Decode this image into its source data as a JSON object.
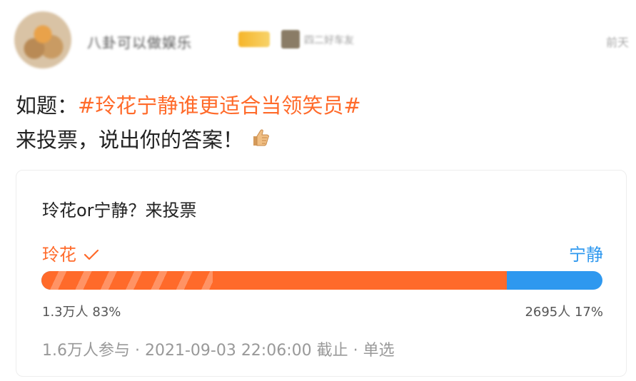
{
  "header": {
    "username": "八卦可以做娱乐",
    "badge_text": "四二好车友",
    "time": "前天"
  },
  "post": {
    "prefix": "如题：",
    "hashtag": "#玲花宁静谁更适合当领笑员#",
    "line2": "来投票，说出你的答案！",
    "emoji_icon": "thumbs-up-icon"
  },
  "poll": {
    "title": "玲花or宁静？来投票",
    "option_a": {
      "label": "玲花",
      "count": "1.3万人",
      "percent": "83%",
      "share": 0.83,
      "color": "#ff6a2a"
    },
    "option_b": {
      "label": "宁静",
      "count": "2695人",
      "percent": "17%",
      "share": 0.17,
      "color": "#2e98ef"
    },
    "meta": "1.6万人参与 · 2021-09-03 22:06:00 截止 · 单选"
  }
}
